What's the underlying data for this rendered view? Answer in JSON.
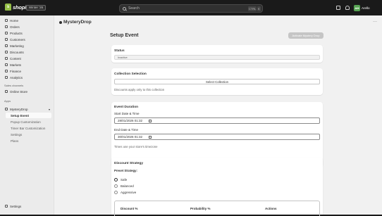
{
  "topbar": {
    "brand": "shopify",
    "edition_badge": "Winter '26",
    "search_placeholder": "Search",
    "shortcut_ctrl": "CTRL",
    "shortcut_key": "K",
    "avatar_initials": "AM",
    "user_name": "Arello"
  },
  "sidebar": {
    "items": [
      {
        "label": "Home"
      },
      {
        "label": "Orders"
      },
      {
        "label": "Products"
      },
      {
        "label": "Customers"
      },
      {
        "label": "Marketing"
      },
      {
        "label": "Discounts"
      },
      {
        "label": "Content"
      },
      {
        "label": "Markets"
      },
      {
        "label": "Finance"
      },
      {
        "label": "Analytics"
      }
    ],
    "sales_channels_label": "Sales channels",
    "online_store": "Online Store",
    "apps_label": "Apps",
    "app_name": "MysteryDrop",
    "app_sub_items": [
      {
        "label": "Setup Event"
      },
      {
        "label": "Popup Customization"
      },
      {
        "label": "Timer Bar Customization"
      },
      {
        "label": "Settings"
      },
      {
        "label": "Plans"
      }
    ],
    "settings": "Settings"
  },
  "app_header": {
    "title": "MysteryDrop",
    "more": "···"
  },
  "page": {
    "title": "Setup Event",
    "primary_button": "Activate Mystery Drop"
  },
  "status_card": {
    "title": "Status",
    "value": "Inactive"
  },
  "collection_card": {
    "title": "Collection Selection",
    "button": "Select Collection",
    "help": "Discounts apply only to this collection"
  },
  "duration_card": {
    "title": "Event Duration",
    "start_label": "Start Date & Time",
    "start_value": "28/01/2026 01:32",
    "end_label": "End Date & Time",
    "end_value": "30/01/2026 01:32",
    "help": "Times use your store's timezone"
  },
  "strategy_card": {
    "title": "Discount Strategy",
    "preset_label": "Preset Strategy:",
    "options": [
      {
        "label": "Safe",
        "selected": true
      },
      {
        "label": "Balanced",
        "selected": false
      },
      {
        "label": "Aggressive",
        "selected": false
      }
    ],
    "table_headers": [
      "Discount %",
      "Probability %",
      "Actions"
    ]
  }
}
